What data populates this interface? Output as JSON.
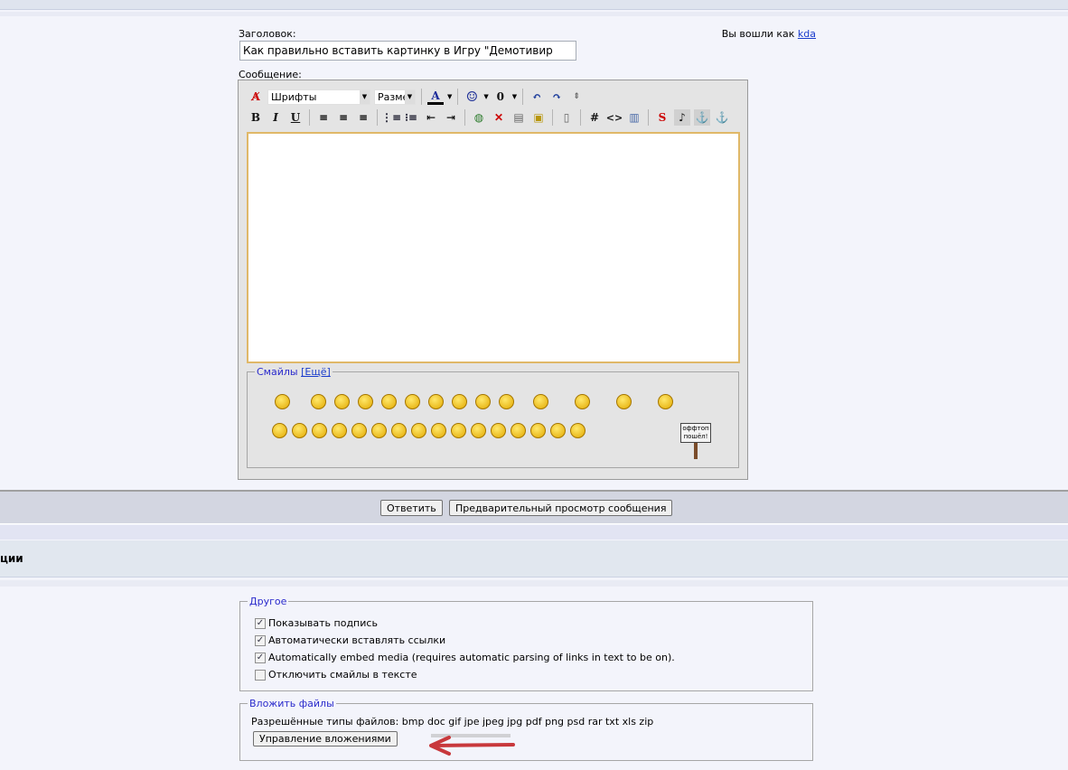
{
  "header": {
    "subject_label": "Заголовок:",
    "subject_value": "Как правильно вставить картинку в Игру \"Демотивир",
    "logged_in_text": "Вы вошли как",
    "username": "kda",
    "message_label": "Сообщение:"
  },
  "toolbar": {
    "font_select": "Шрифты",
    "size_select": "Разме",
    "row1_icons": [
      "remove-format-icon",
      "text-color-icon",
      "smiley-icon",
      "attachment-icon",
      "undo-icon",
      "redo-icon",
      "resize-icon"
    ],
    "row2": {
      "bold": "B",
      "italic": "I",
      "underline": "U",
      "hash": "#",
      "code": "<>"
    }
  },
  "smiles": {
    "legend": "Смайлы",
    "more_link": "[Ещё]",
    "sign_line1": "оффтоп",
    "sign_line2": "пошёл!",
    "row1_count": 14,
    "row2_count": 16
  },
  "buttons": {
    "reply": "Ответить",
    "preview": "Предварительный просмотр сообщения"
  },
  "section_title": "ции",
  "other": {
    "legend": "Другое",
    "options": [
      {
        "label": "Показывать подпись",
        "checked": true
      },
      {
        "label": "Автоматически вставлять ссылки",
        "checked": true
      },
      {
        "label": "Automatically embed media (requires automatic parsing of links in text to be on).",
        "checked": true
      },
      {
        "label": "Отключить смайлы в тексте",
        "checked": false
      }
    ]
  },
  "attach": {
    "legend": "Вложить файлы",
    "allowed_text": "Разрешённые типы файлов: bmp doc gif jpe jpeg jpg pdf png psd rar txt xls zip",
    "manage_button": "Управление вложениями"
  },
  "colors": {
    "annotation_arrow": "#c8383c",
    "textarea_border": "#e0b868"
  }
}
